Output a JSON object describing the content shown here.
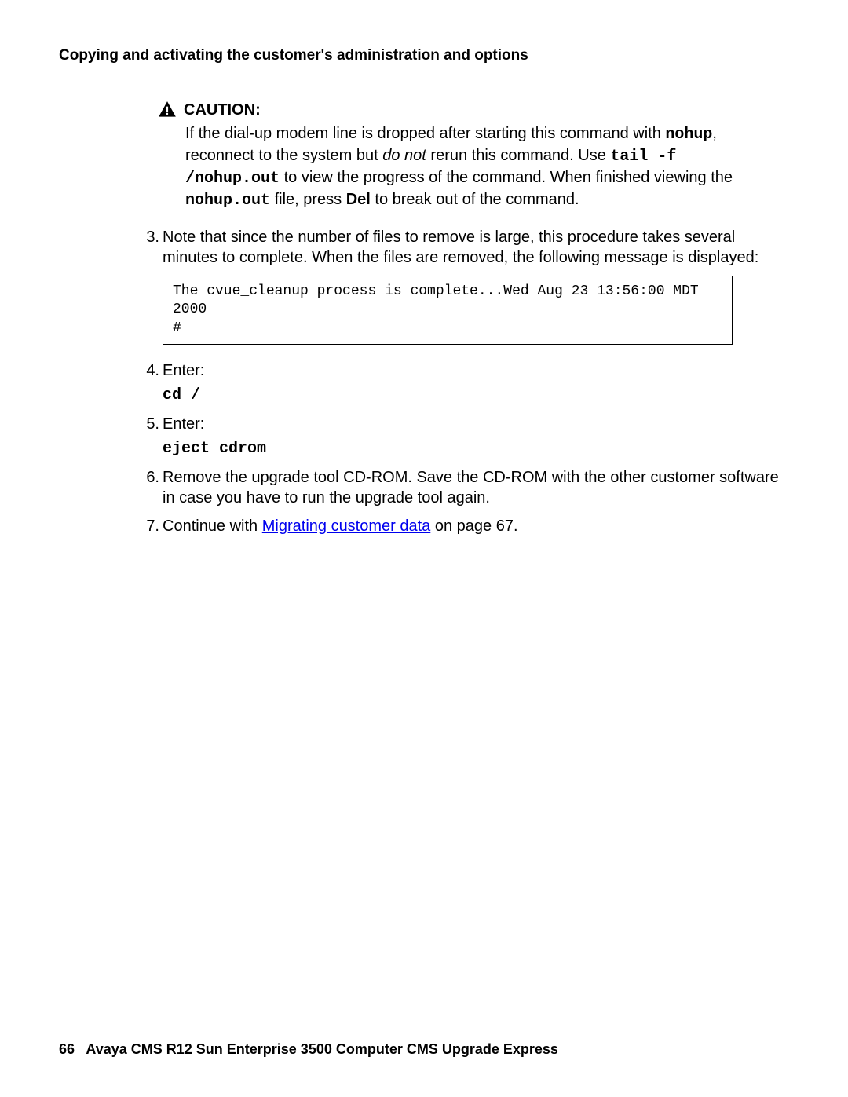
{
  "header": "Copying and activating the customer's administration and options",
  "caution": {
    "label": "CAUTION:",
    "p1a": "If the dial-up modem line is dropped after starting this command with ",
    "p1_cmd1": "nohup",
    "p1b": ", reconnect to the system but ",
    "p1_em": "do not",
    "p1c": " rerun this command. Use ",
    "p1_cmd2": "tail -f /nohup.out",
    "p1d": " to view the progress of the command. When finished viewing the ",
    "p1_cmd3": "nohup.out",
    "p1e": " file, press ",
    "p1_key": "Del",
    "p1f": " to break out of the command."
  },
  "steps": {
    "s3": {
      "num": "3.",
      "text": "Note that since the number of files to remove is large, this procedure takes several minutes to complete. When the files are removed, the following message is displayed:",
      "code": "The cvue_cleanup process is complete...Wed Aug 23 13:56:00 MDT 2000\n#"
    },
    "s4": {
      "num": "4.",
      "text": "Enter:",
      "cmd": "cd /"
    },
    "s5": {
      "num": "5.",
      "text": "Enter:",
      "cmd": "eject cdrom"
    },
    "s6": {
      "num": "6.",
      "text": "Remove the upgrade tool CD-ROM. Save the CD-ROM with the other customer software in case you have to run the upgrade tool again."
    },
    "s7": {
      "num": "7.",
      "pre": "Continue with ",
      "link": "Migrating customer data",
      "post": " on page 67."
    }
  },
  "footer": {
    "page": "66",
    "title": "Avaya CMS R12 Sun Enterprise 3500 Computer CMS Upgrade Express"
  }
}
